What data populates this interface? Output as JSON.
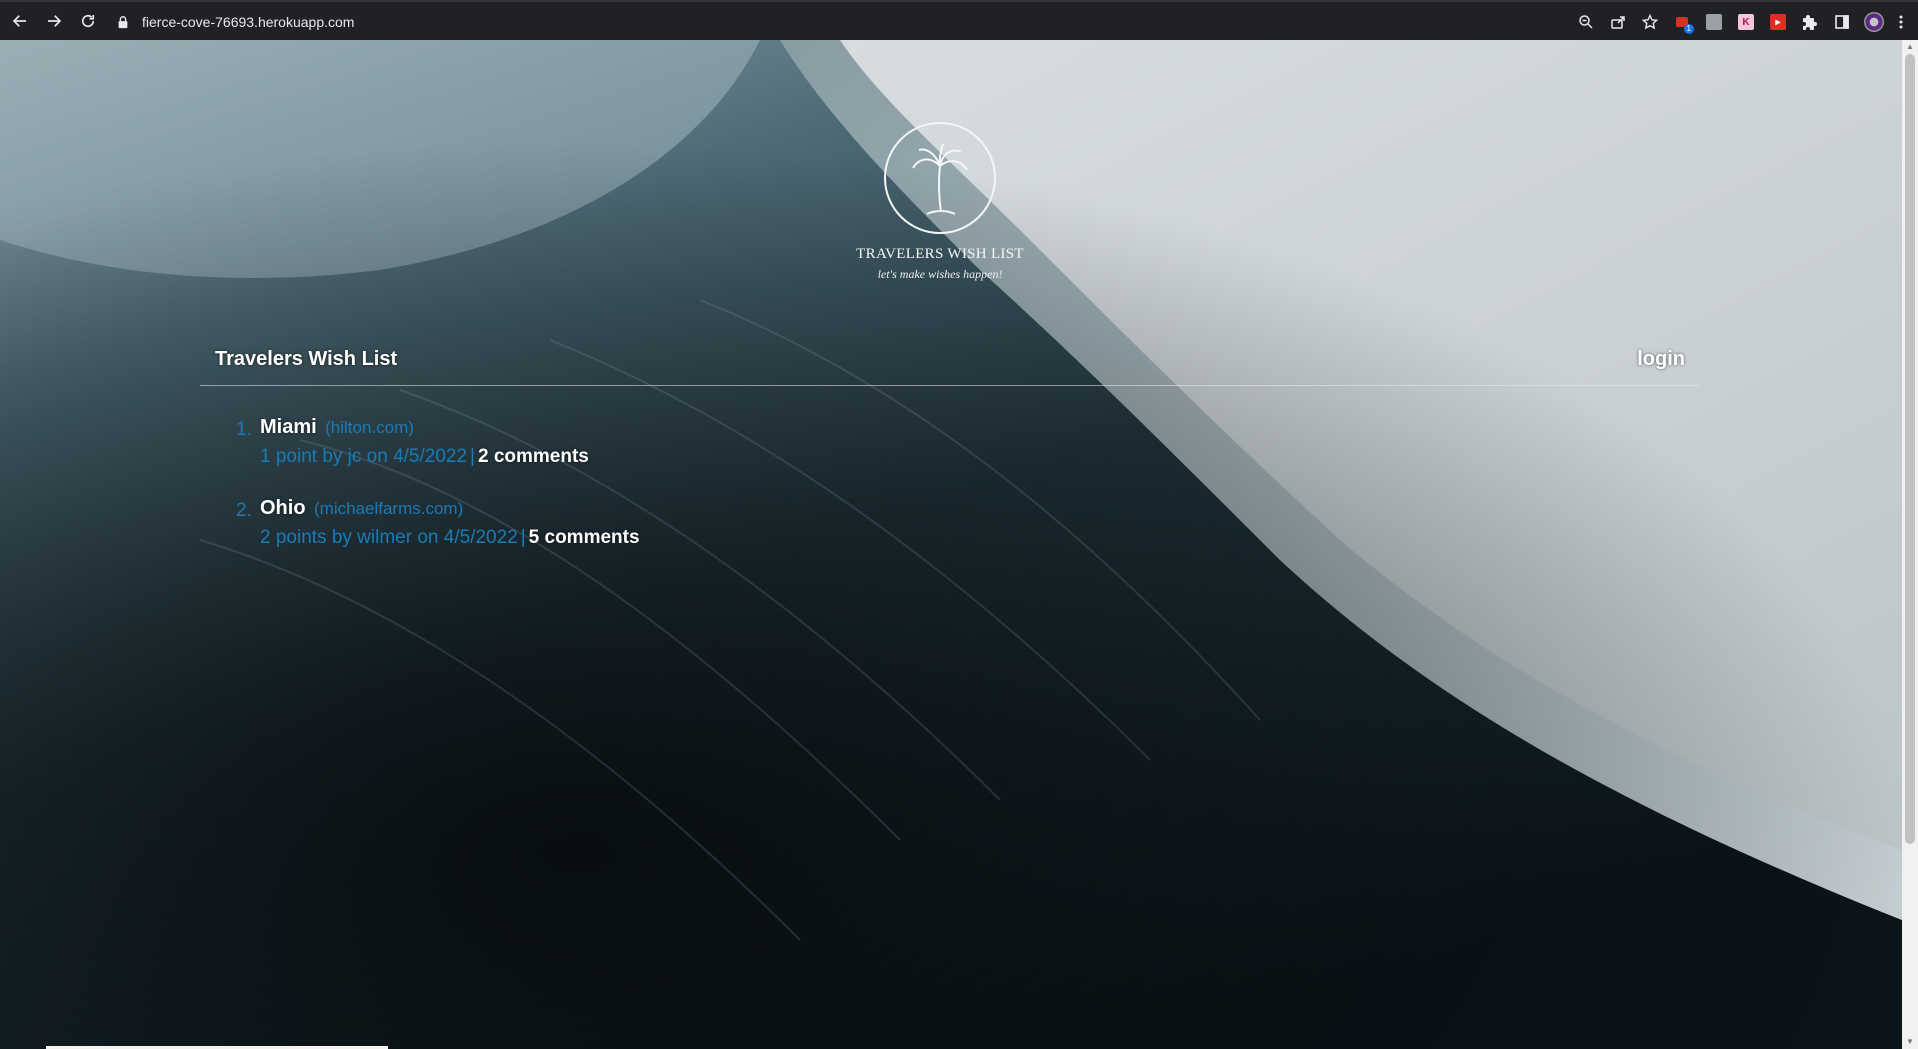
{
  "browser": {
    "url": "fierce-cove-76693.herokuapp.com",
    "back_icon": "arrow-left-icon",
    "forward_icon": "arrow-right-icon",
    "reload_icon": "reload-icon",
    "extension_badge": "1"
  },
  "logo": {
    "title": "TRAVELERS WISH LIST",
    "tagline": "let's make wishes happen!"
  },
  "nav": {
    "brand": "Travelers Wish List",
    "login": "login"
  },
  "posts": [
    {
      "number": "1.",
      "title": "Miami",
      "domain": "(hilton.com)",
      "meta": "1 point by jc on 4/5/2022",
      "separator": "|",
      "comments": "2 comments"
    },
    {
      "number": "2.",
      "title": "Ohio",
      "domain": "(michaelfarms.com)",
      "meta": "2 points by wilmer on 4/5/2022",
      "separator": "|",
      "comments": "5 comments"
    }
  ],
  "colors": {
    "link_blue": "#1a7bb5",
    "chrome_bg": "#202124",
    "text_white": "#ffffff"
  }
}
